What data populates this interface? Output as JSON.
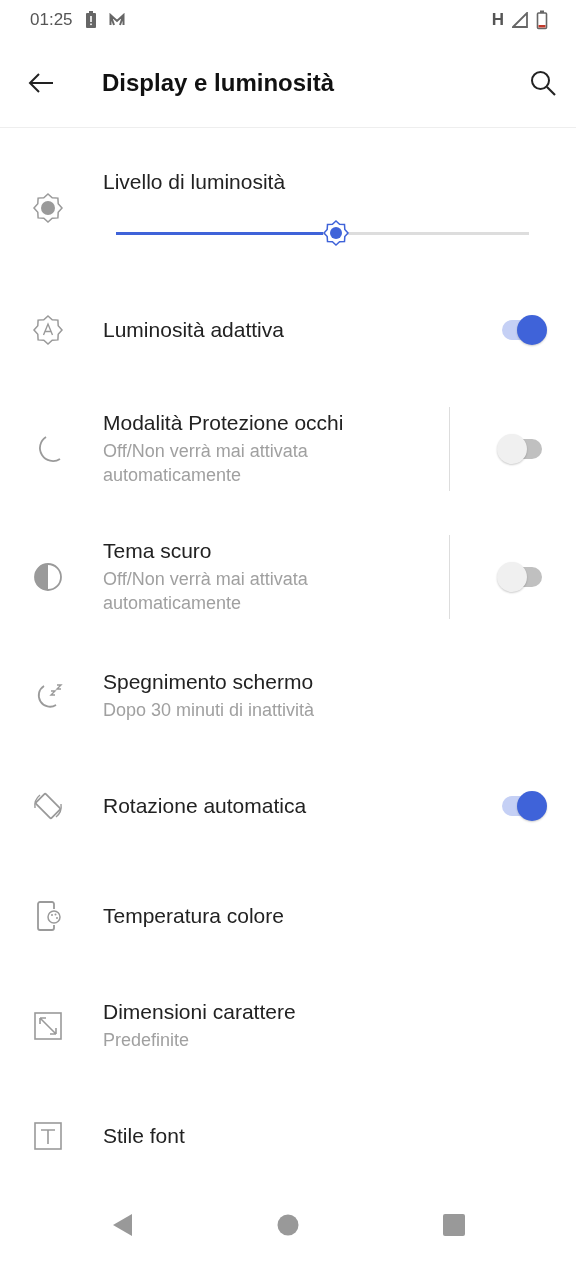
{
  "status_bar": {
    "time": "01:25",
    "network": "H"
  },
  "header": {
    "title": "Display e luminosità"
  },
  "settings": [
    {
      "kind": "slider",
      "title": "Livello di luminosità",
      "level": 0.5
    },
    {
      "kind": "toggle",
      "title": "Luminosità adattiva",
      "on": true
    },
    {
      "kind": "split_toggle",
      "title": "Modalità Protezione occhi",
      "subtitle": "Off/Non verrà mai attivata automaticamente",
      "on": false
    },
    {
      "kind": "split_toggle",
      "title": "Tema scuro",
      "subtitle": "Off/Non verrà mai attivata automaticamente",
      "on": false
    },
    {
      "kind": "link",
      "title": "Spegnimento schermo",
      "subtitle": "Dopo 30 minuti di inattività"
    },
    {
      "kind": "toggle",
      "title": "Rotazione automatica",
      "on": true
    },
    {
      "kind": "link",
      "title": "Temperatura colore"
    },
    {
      "kind": "link",
      "title": "Dimensioni carattere",
      "subtitle": "Predefinite"
    },
    {
      "kind": "link",
      "title": "Stile font"
    }
  ]
}
